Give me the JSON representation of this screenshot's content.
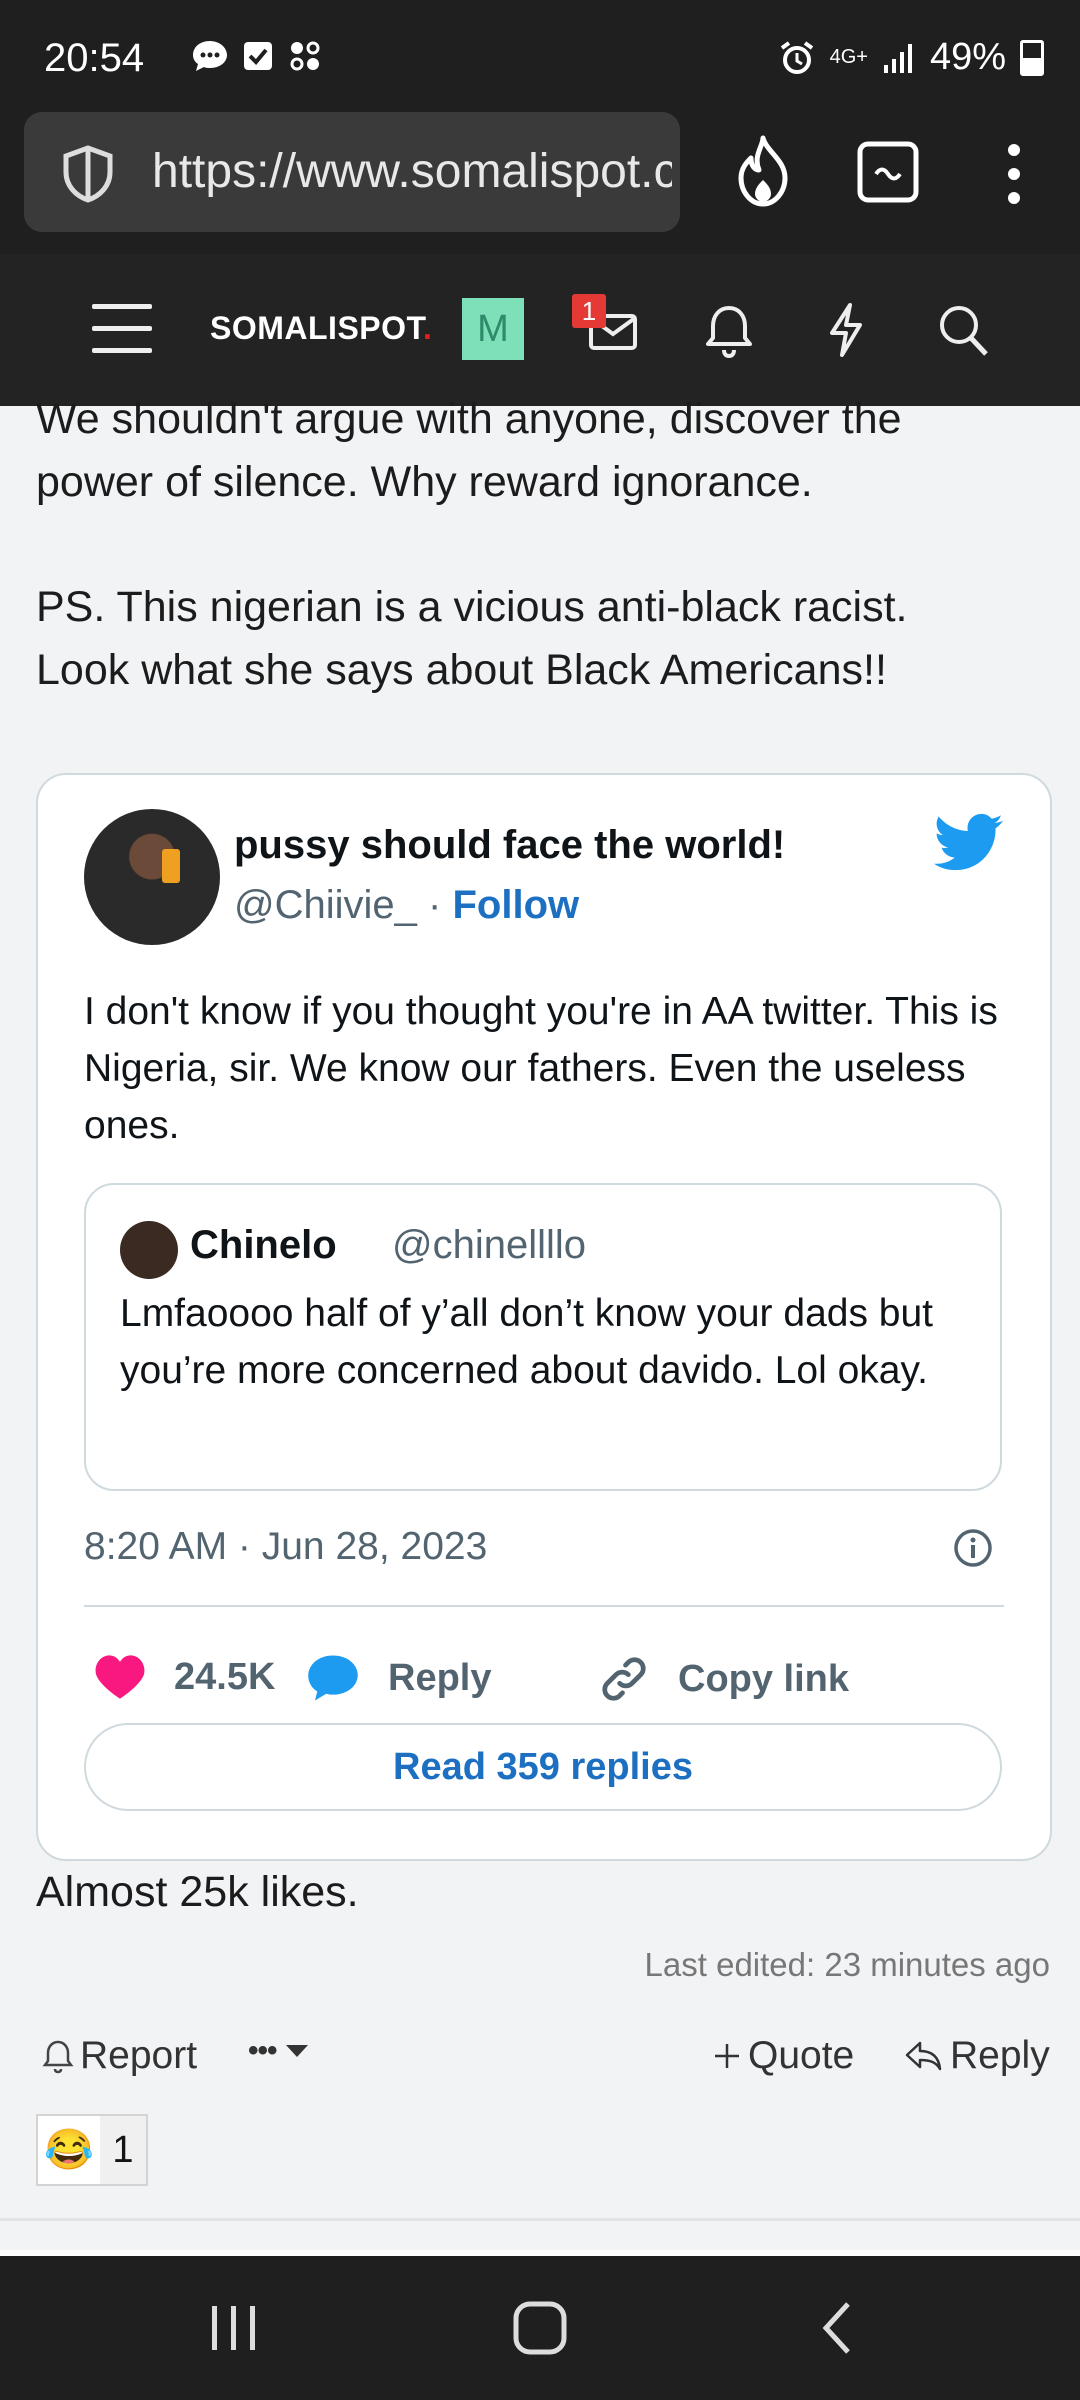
{
  "status_bar": {
    "time": "20:54",
    "network": "4G+",
    "battery": "49%",
    "icons": [
      "chat-icon",
      "check-box-icon",
      "grid-icon",
      "alarm-icon",
      "signal-icon",
      "battery-icon"
    ]
  },
  "browser": {
    "url": "https://www.somalispot.com",
    "icons": [
      "shield-icon",
      "fire-icon",
      "tab-switcher-icon",
      "more-icon"
    ]
  },
  "site_nav": {
    "logo": "SOMALISPOT",
    "avatar_letter": "M",
    "inbox_badge": "1",
    "icons": [
      "hamburger-menu-icon",
      "envelope-icon",
      "bell-icon",
      "lightning-icon",
      "search-icon"
    ]
  },
  "post": {
    "text_line1": "We shouldn't argue with anyone, discover the",
    "text_line2": "power of silence. Why reward ignorance.",
    "text_line3": "PS. This nigerian is a vicious anti-black racist.",
    "text_line4": "Look what she says about Black Americans!!",
    "after_embed": "Almost 25k likes.",
    "last_edited": "Last edited: 23 minutes ago",
    "footer": {
      "report": "Report",
      "more": "•••",
      "quote": "Quote",
      "reply": "Reply"
    },
    "reaction": {
      "emoji": "😂",
      "count": "1"
    }
  },
  "tweet": {
    "author_name": "pussy should face the world!",
    "handle": "@Chiivie_",
    "separator": "·",
    "follow": "Follow",
    "text": "I don't know if you thought you're in AA twitter. This is Nigeria, sir. We know our fathers. Even the useless ones.",
    "quoted": {
      "name": "Chinelo",
      "handle": "@chinellllo",
      "text": "Lmfaoooo half of y’all don’t know your dads but you’re more concerned about davido. Lol okay."
    },
    "timestamp": "8:20 AM · Jun 28, 2023",
    "likes": "24.5K",
    "reply_label": "Reply",
    "copy_link_label": "Copy link",
    "read_replies": "Read 359 replies",
    "colors": {
      "like": "#f91880",
      "reply": "#1d9bf0",
      "link": "#1d6fc2",
      "bird": "#1d9bf0"
    }
  }
}
